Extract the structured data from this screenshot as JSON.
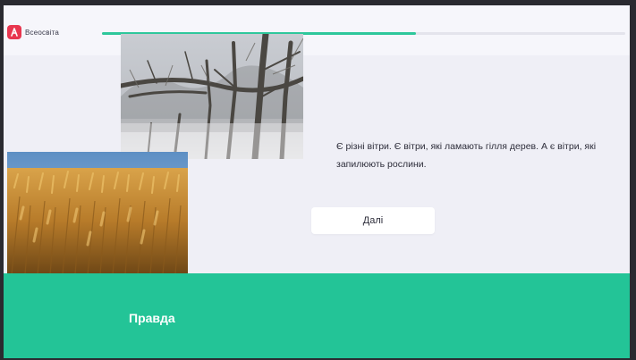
{
  "app": {
    "name": "Всеосвіта",
    "brand_color": "#e8364f"
  },
  "progress": {
    "percent": 60,
    "color": "#2ec79b"
  },
  "statement": "Є різні вітри. Є вітри, які ламають гілля дерев. А є вітри, які запилюють рослини.",
  "next_button": {
    "label": "Далі"
  },
  "answer": {
    "label": "Правда",
    "color": "#23c497"
  },
  "images": {
    "winter": "winter-trees-photo",
    "wheat": "wheat-field-photo"
  }
}
